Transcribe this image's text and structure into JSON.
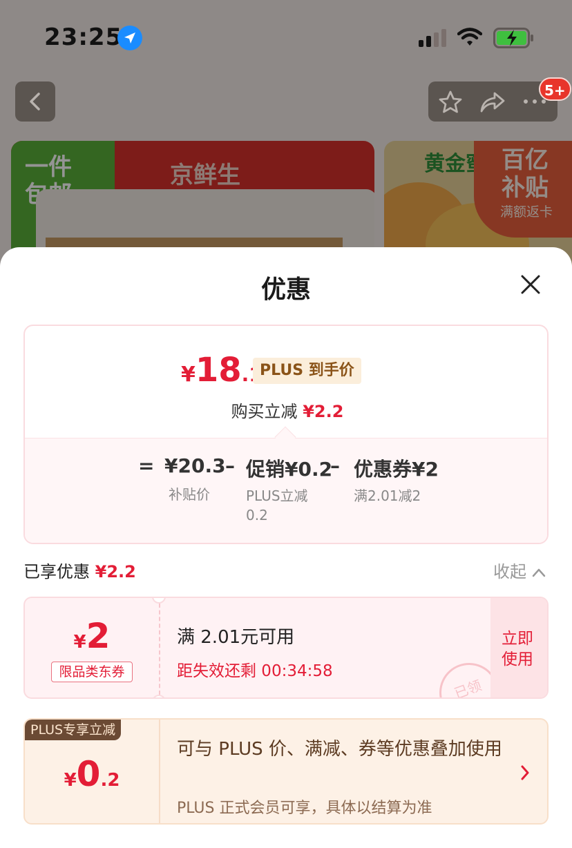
{
  "status_bar": {
    "time": "23:25"
  },
  "nav": {
    "message_badge": "5+"
  },
  "banners": {
    "left_tag": "一件\n包邮",
    "left_brand": "京鲜生",
    "right_title": "黄金蜜",
    "right_badge": "百亿\n补贴",
    "right_badge_sub": "满额返卡"
  },
  "sheet": {
    "title": "优惠",
    "summary": {
      "currency": "¥",
      "final_int": "18",
      "final_dec": ".1",
      "plus_tag": "PLUS 到手价",
      "cut_label": "购买立减",
      "cut_value": "¥2.2",
      "equation": {
        "eq": "=",
        "base_value": "¥20.3",
        "base_label": "补贴价",
        "minus1": "–",
        "promo_value": "促销¥0.2",
        "promo_label": "PLUS立减\n0.2",
        "minus2": "–",
        "coupon_value": "优惠券¥2",
        "coupon_label": "满2.01减2"
      }
    },
    "enjoyed": {
      "label": "已享优惠",
      "value": "¥2.2",
      "collapse": "收起"
    },
    "coupon": {
      "currency": "¥",
      "amount": "2",
      "type": "限品类东券",
      "condition": "满 2.01元可用",
      "countdown": "距失效还剩 00:34:58",
      "use_button": "立即\n使用",
      "stamp": "已领"
    },
    "plus_card": {
      "label": "PLUS专享立减",
      "currency": "¥",
      "amount_int": "0",
      "amount_dec": ".2",
      "description": "可与 PLUS 价、满减、券等优惠叠加使用",
      "note": "PLUS 正式会员可享，具体以结算为准"
    }
  },
  "colors": {
    "accent_red": "#e31d36",
    "plus_brown": "#6b4a34",
    "location_blue": "#1a8cff"
  }
}
